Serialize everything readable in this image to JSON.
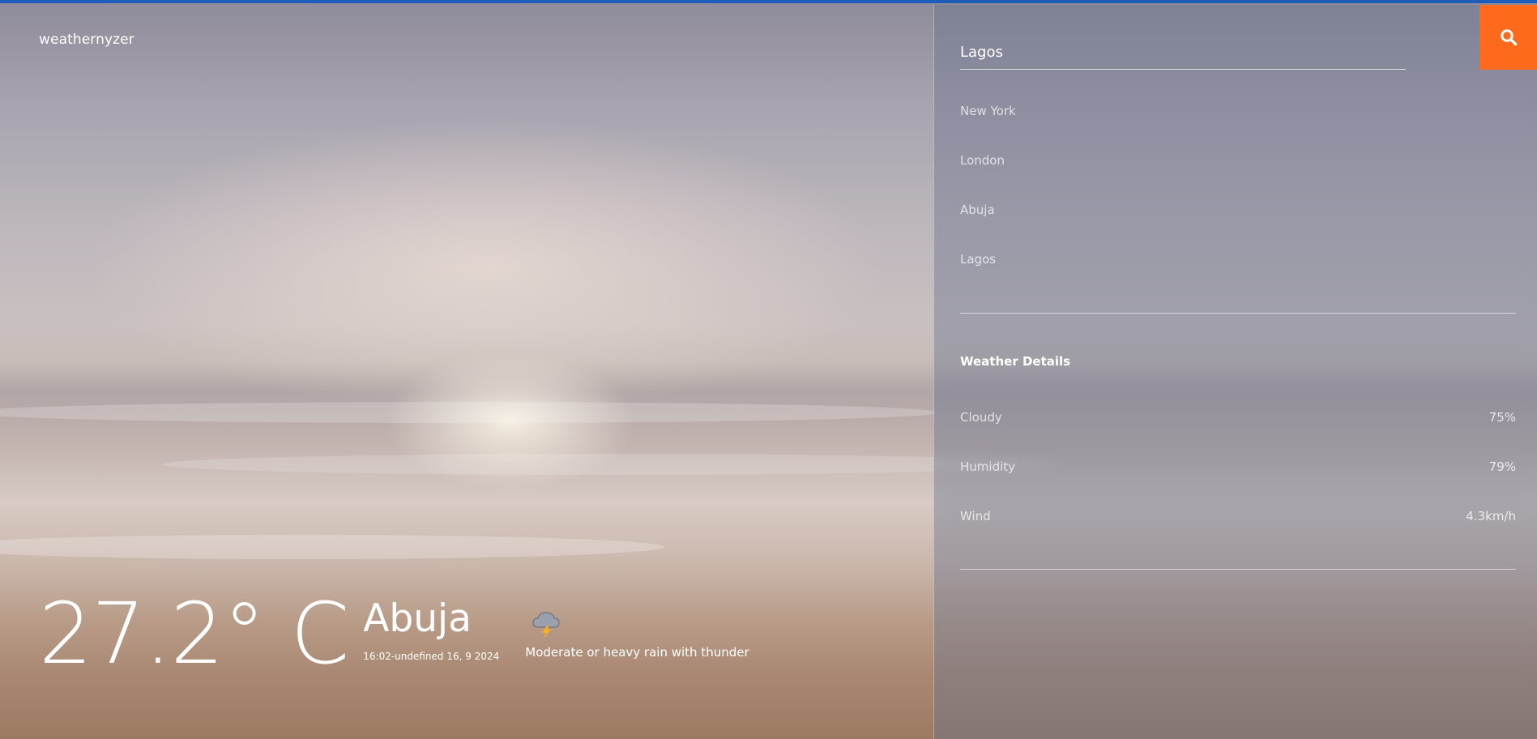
{
  "app": {
    "logo": "weathernyzer"
  },
  "current": {
    "temperature": "27.2° C",
    "city": "Abuja",
    "datetime": "16:02-undefined 16, 9 2024",
    "condition_icon": "thunderstorm-cloud-icon",
    "condition": "Moderate or heavy rain with thunder"
  },
  "sidebar": {
    "search": {
      "value": "Lagos",
      "icon": "search-icon"
    },
    "cities": [
      "New York",
      "London",
      "Abuja",
      "Lagos"
    ],
    "details_title": "Weather Details",
    "details": [
      {
        "label": "Cloudy",
        "value": "75%"
      },
      {
        "label": "Humidity",
        "value": "79%"
      },
      {
        "label": "Wind",
        "value": "4.3km/h"
      }
    ]
  },
  "colors": {
    "accent": "#fd6a1b",
    "topline": "#1d5cb8"
  }
}
